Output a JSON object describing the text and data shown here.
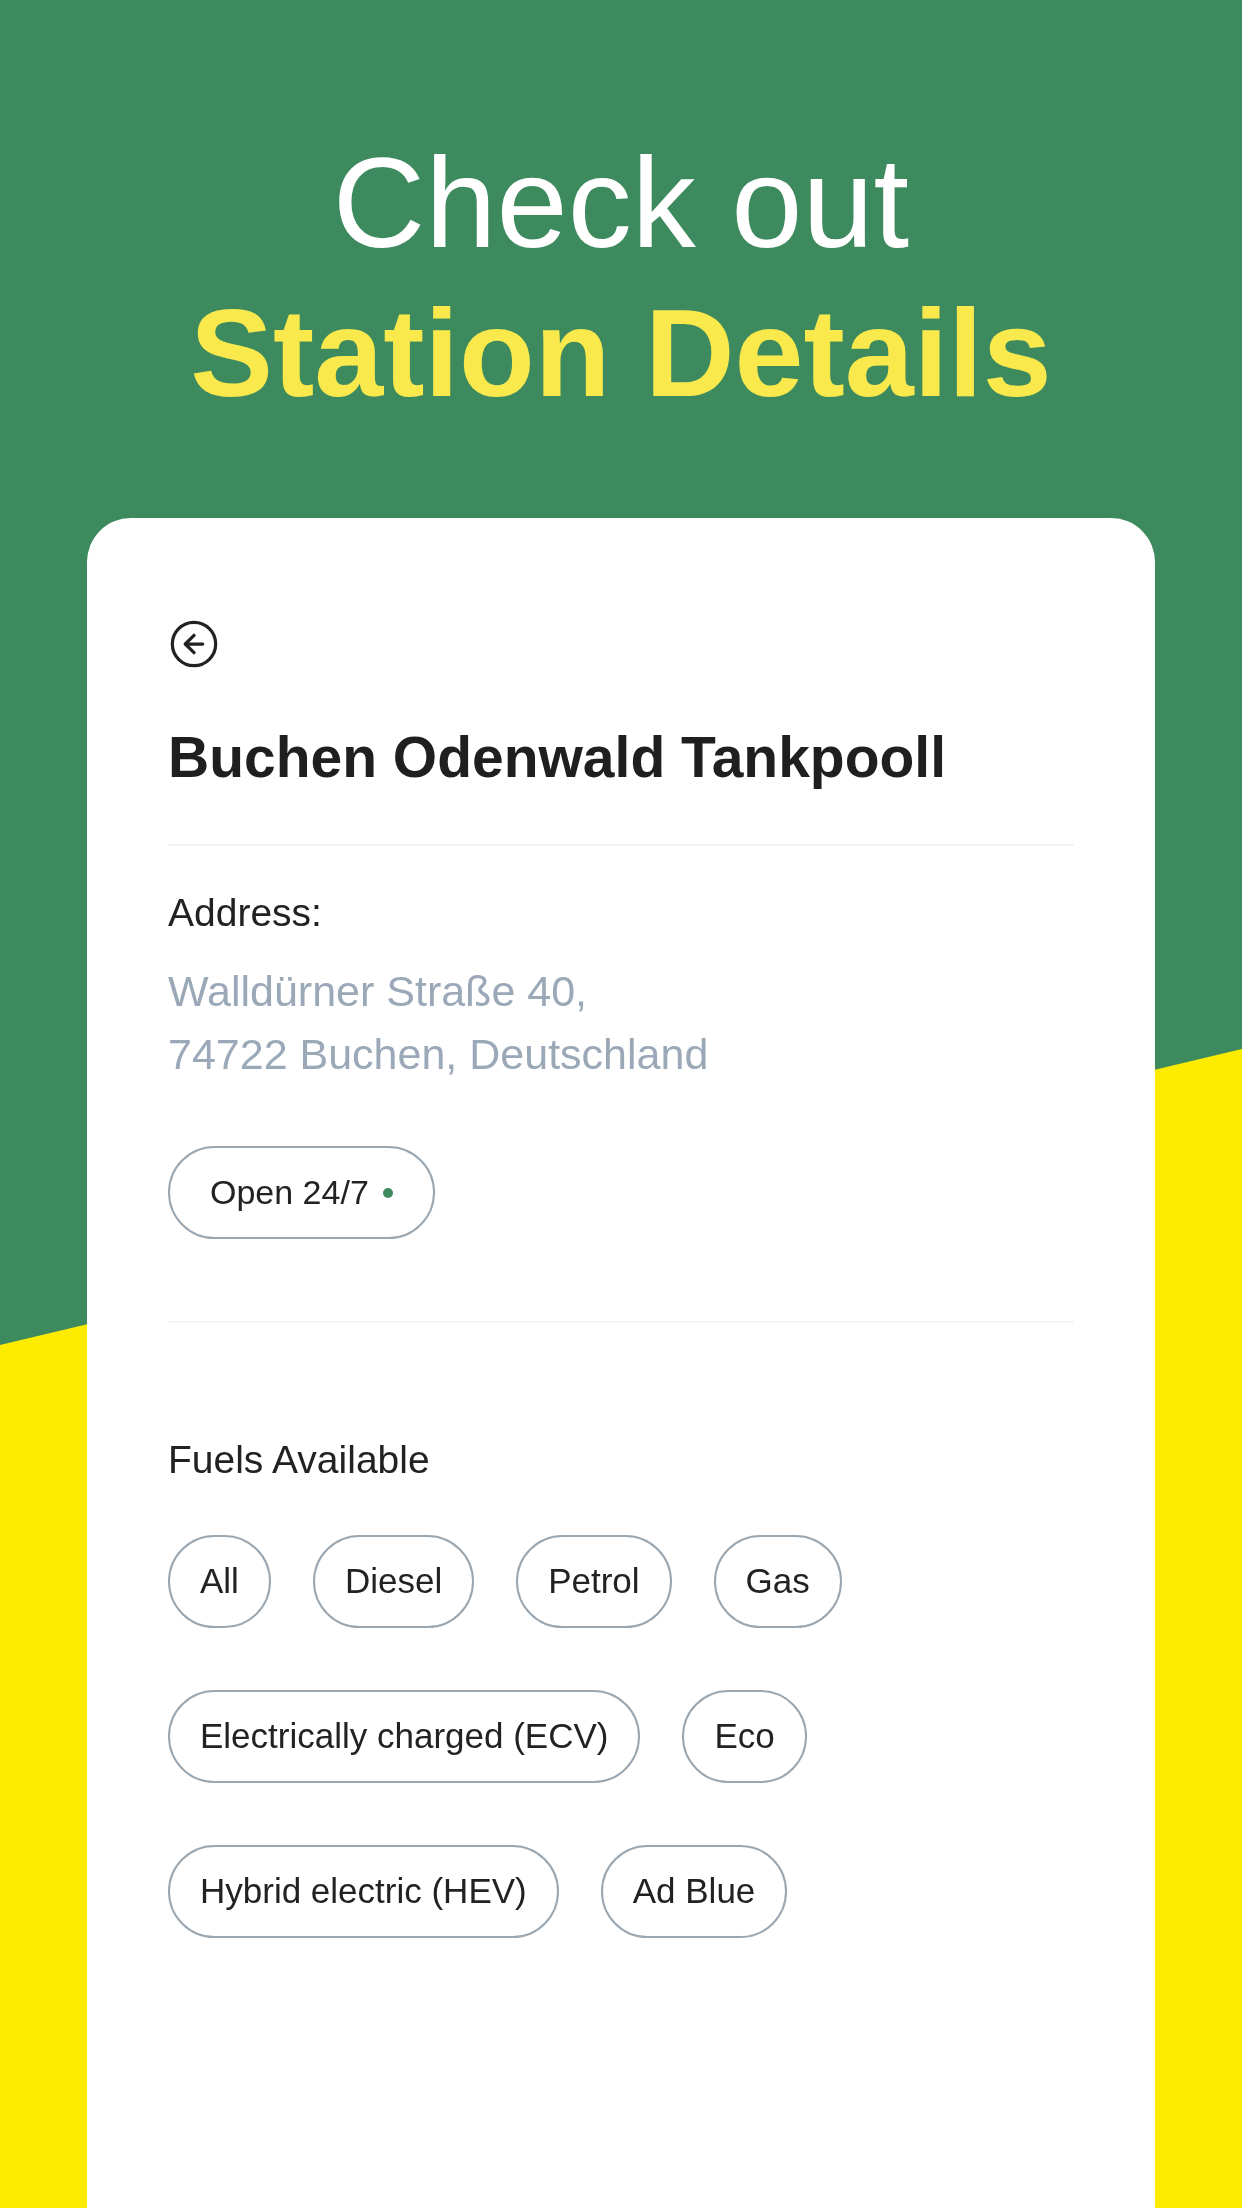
{
  "headline": {
    "line1": "Check out",
    "line2": "Station Details"
  },
  "station": {
    "name": "Buchen Odenwald Tankpooll",
    "address_label": "Address:",
    "address_lines": [
      "Walldürner Straße 40,",
      "74722 Buchen, Deutschland"
    ],
    "status": "Open 24/7"
  },
  "fuels": {
    "title": "Fuels Available",
    "options": [
      "All",
      "Diesel",
      "Petrol",
      "Gas",
      "Electrically charged (ECV)",
      "Eco",
      "Hybrid electric (HEV)",
      "Ad Blue"
    ]
  }
}
